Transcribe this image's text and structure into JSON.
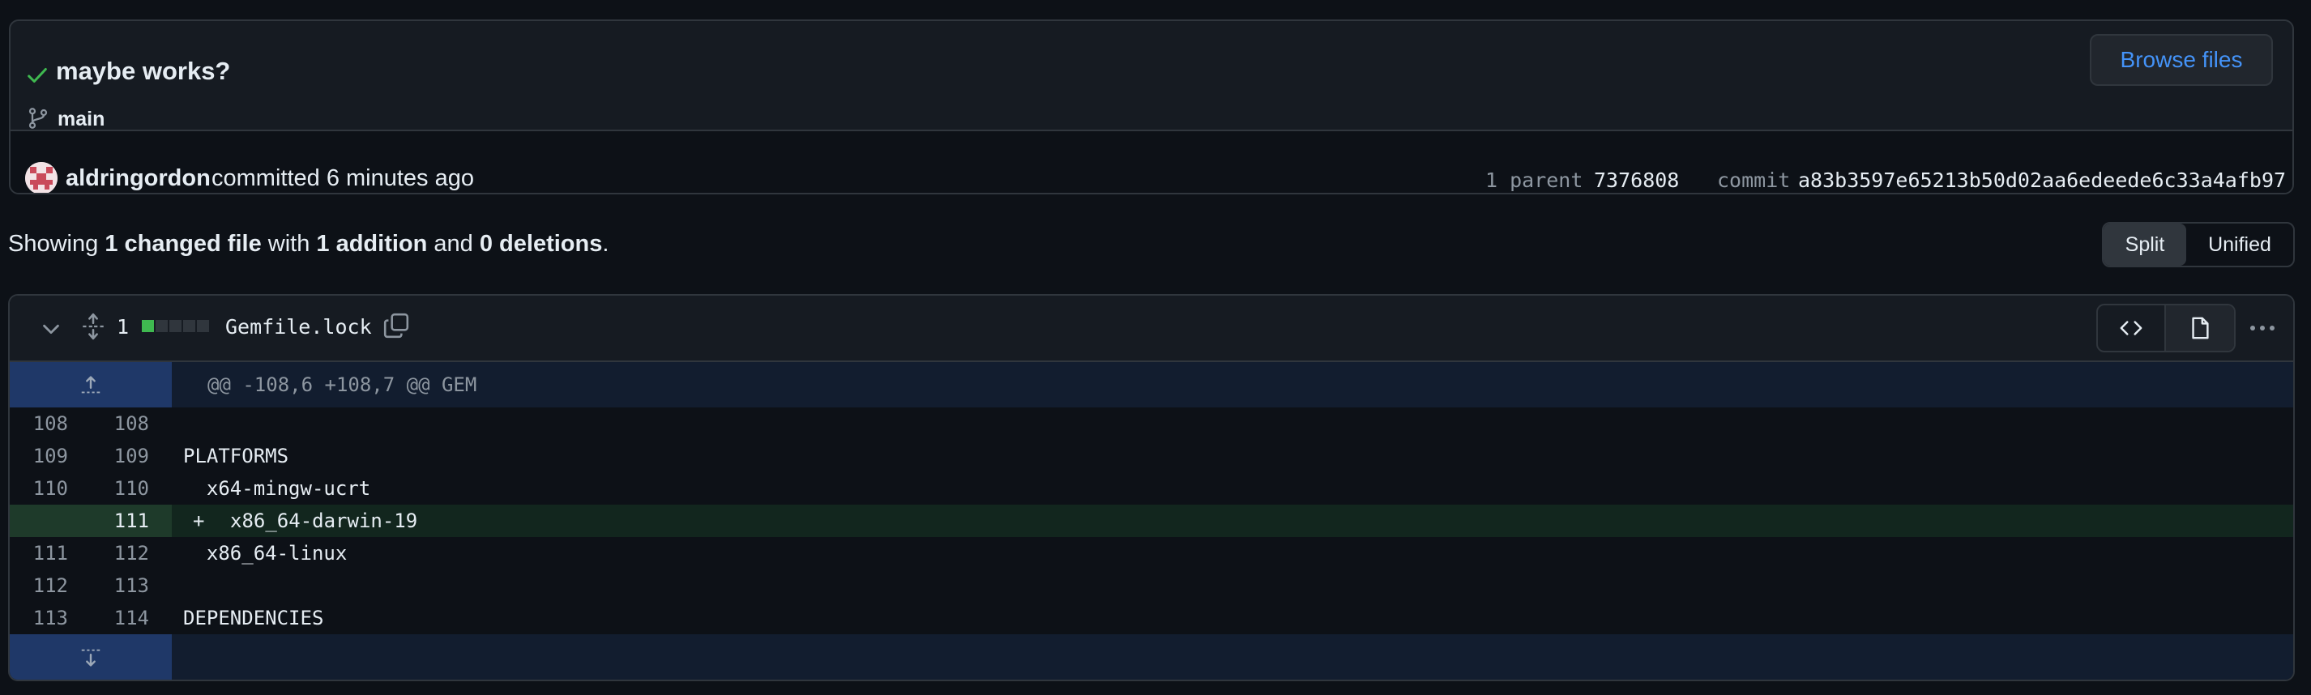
{
  "commit": {
    "title": "maybe works?",
    "branch": "main",
    "browse_label": "Browse files",
    "author": "aldringordon",
    "committed_text": "committed 6 minutes ago",
    "parent_label": "1 parent",
    "parent_sha": "7376808",
    "commit_label": "commit",
    "commit_sha": "a83b3597e65213b50d02aa6edeede6c33a4afb97"
  },
  "summary": {
    "prefix": "Showing",
    "changed": "1 changed file",
    "with": "with",
    "additions": "1 addition",
    "and": "and",
    "deletions": "0 deletions",
    "suffix": "."
  },
  "view_toggle": {
    "split": "Split",
    "unified": "Unified"
  },
  "file": {
    "change_count": "1",
    "name": "Gemfile.lock",
    "diffstat": [
      "added",
      "neutral",
      "neutral",
      "neutral",
      "neutral"
    ],
    "hunk_header": "@@ -108,6 +108,7 @@ GEM",
    "lines": [
      {
        "old": "108",
        "new": "108",
        "type": "context",
        "text": ""
      },
      {
        "old": "109",
        "new": "109",
        "type": "context",
        "text": "PLATFORMS",
        "keyword": true
      },
      {
        "old": "110",
        "new": "110",
        "type": "context",
        "text": "  x64-mingw-ucrt"
      },
      {
        "old": "",
        "new": "111",
        "type": "added",
        "marker": "+",
        "text": "x86_64-darwin-19"
      },
      {
        "old": "111",
        "new": "112",
        "type": "context",
        "text": "  x86_64-linux"
      },
      {
        "old": "112",
        "new": "113",
        "type": "context",
        "text": ""
      },
      {
        "old": "113",
        "new": "114",
        "type": "context",
        "text": "DEPENDENCIES",
        "keyword": true
      }
    ]
  },
  "colors": {
    "background": "#0d1117",
    "accent_link": "#4493f8",
    "added_line": "#12261e",
    "added_gutter": "#1e3a2a",
    "hunk_bg": "#121d2f",
    "expander_bg": "#1f3868",
    "keyword": "#ff7b72",
    "success": "#3fb950"
  }
}
